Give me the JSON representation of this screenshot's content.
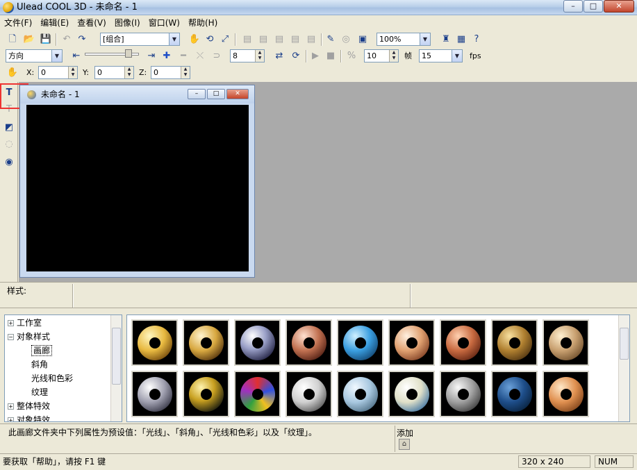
{
  "window": {
    "title": "Ulead COOL 3D - 未命名 - 1",
    "controls": {
      "minimize": "–",
      "maximize": "□",
      "close": "✕"
    }
  },
  "menu": [
    "文件(F)",
    "编辑(E)",
    "查看(V)",
    "图像(I)",
    "窗口(W)",
    "帮助(H)"
  ],
  "toolbar1": {
    "object_combo": "[组合]",
    "zoom_combo": "100%"
  },
  "toolbar2": {
    "direction_combo": "方向",
    "spin1": "8",
    "spin2": "10",
    "frame_label": "帧",
    "frame_combo": "15",
    "fps_label": "fps"
  },
  "toolbar3": {
    "x_label": "X:",
    "x_value": "0",
    "y_label": "Y:",
    "y_value": "0",
    "z_label": "Z:",
    "z_value": "0"
  },
  "document": {
    "title": "未命名 - 1",
    "controls": {
      "minimize": "–",
      "maximize": "□",
      "close": "✕"
    }
  },
  "style_bar": {
    "label": "样式:"
  },
  "tree": {
    "items": [
      {
        "label": "工作室",
        "expander": "+"
      },
      {
        "label": "对象样式",
        "expander": "−"
      },
      {
        "label": "画廊"
      },
      {
        "label": "斜角"
      },
      {
        "label": "光线和色彩"
      },
      {
        "label": "纹理"
      },
      {
        "label": "整体特效",
        "expander": "+"
      },
      {
        "label": "对象特效",
        "expander": "+"
      }
    ]
  },
  "description": {
    "text": "此画廊文件夹中下列属性为预设值：「光线」、「斜角」、「光线和色彩」以及「纹理」。",
    "add_label": "添加"
  },
  "status": {
    "help_text": "要获取「帮助」，请按 F1 键",
    "resolution": "320 x 240",
    "num": "NUM"
  },
  "colors": {
    "canvas": "#000000",
    "workspace": "#aaaaaa",
    "highlight": "#ee3333"
  }
}
